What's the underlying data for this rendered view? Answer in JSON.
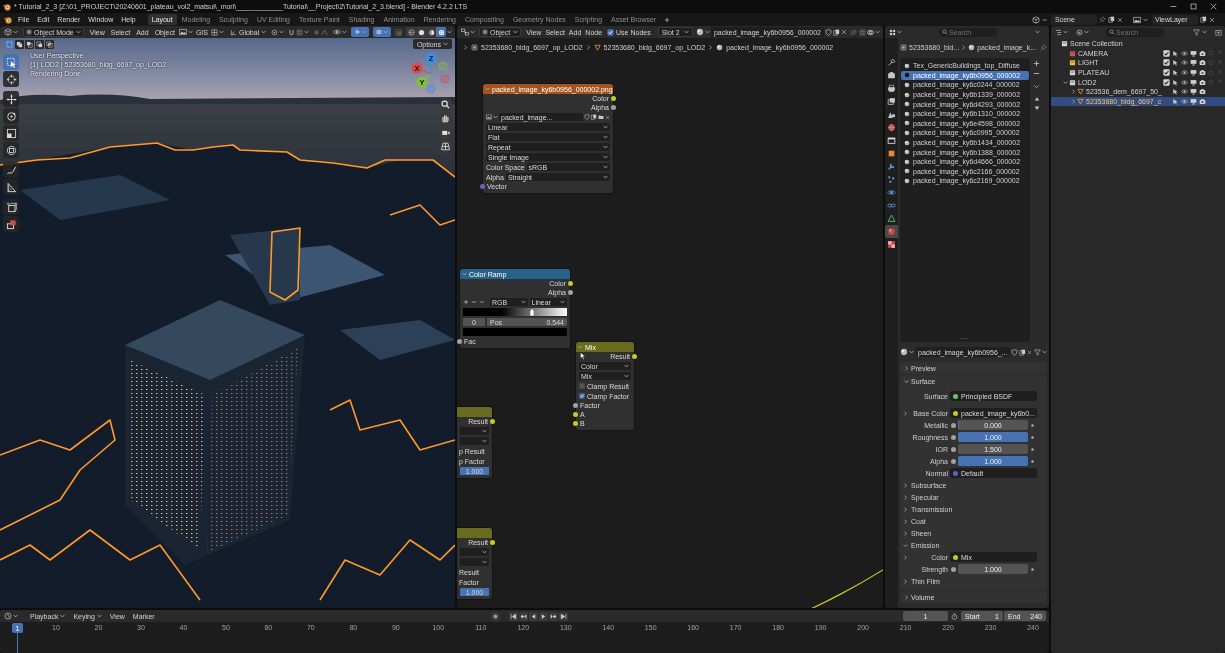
{
  "window": {
    "title": "* Tutorial_2_3 [Z:\\01_PROJECT\\20240601_plateau_vol2_matsui\\_mori\\____________Tutorial\\__Project\\2\\Tutorial_2_3.blend] - Blender 4.2.2 LTS"
  },
  "menu": [
    "File",
    "Edit",
    "Render",
    "Window",
    "Help"
  ],
  "workspaces": [
    {
      "label": "Layout",
      "selected": true
    },
    {
      "label": "Modeling",
      "selected": false
    },
    {
      "label": "Sculpting",
      "selected": false
    },
    {
      "label": "UV Editing",
      "selected": false
    },
    {
      "label": "Texture Paint",
      "selected": false
    },
    {
      "label": "Shading",
      "selected": false
    },
    {
      "label": "Animation",
      "selected": false
    },
    {
      "label": "Rendering",
      "selected": false
    },
    {
      "label": "Compositing",
      "selected": false
    },
    {
      "label": "Geometry Nodes",
      "selected": false
    },
    {
      "label": "Scripting",
      "selected": false
    },
    {
      "label": "Asset Browser",
      "selected": false
    }
  ],
  "scene": {
    "scene": "Scene",
    "view_layer": "ViewLayer"
  },
  "viewport": {
    "header": {
      "mode": "Object Mode",
      "menus": [
        "View",
        "Select",
        "Add",
        "Object"
      ],
      "addon": "GIS",
      "orientation": "Global",
      "toggles": [
        {
          "kind": "gizmo",
          "on": true
        },
        {
          "kind": "overlay",
          "on": true
        }
      ],
      "shading": [
        {
          "kind": "wireframe",
          "selected": false
        },
        {
          "kind": "solid",
          "selected": false
        },
        {
          "kind": "material",
          "selected": false
        },
        {
          "kind": "rendered",
          "selected": true
        }
      ]
    },
    "select_modes": [
      {
        "kind": "new",
        "selected": true
      },
      {
        "kind": "extend",
        "selected": false
      },
      {
        "kind": "subtract",
        "selected": false
      },
      {
        "kind": "invert",
        "selected": false
      },
      {
        "kind": "intersect",
        "selected": false
      }
    ],
    "options": "Options",
    "overlay_text": [
      "User Perspective",
      "(1) LOD2 | 52353680_bldg_6697_op_LOD2",
      "Rendering Done"
    ],
    "tools": [
      {
        "kind": "select_box",
        "selected": true
      },
      {
        "kind": "cursor",
        "selected": false
      },
      {
        "kind": "move",
        "selected": false
      },
      {
        "kind": "rotate",
        "selected": false
      },
      {
        "kind": "scale",
        "selected": false
      },
      {
        "kind": "transform",
        "selected": false
      },
      {
        "kind": "annotate",
        "selected": false
      },
      {
        "kind": "measure",
        "selected": false
      },
      {
        "kind": "add_cube",
        "selected": false
      },
      {
        "kind": "extrude",
        "selected": false
      }
    ],
    "gizmo": [
      {
        "label": "X",
        "color": "#d94a4f"
      },
      {
        "label": "Y",
        "color": "#82c03c"
      },
      {
        "label": "Z",
        "color": "#3b8ee6"
      }
    ]
  },
  "node_editor": {
    "header": {
      "type": "Object",
      "menus": [
        "View",
        "Select",
        "Add",
        "Node"
      ],
      "use_nodes": {
        "label": "Use Nodes",
        "checked": true
      },
      "slot": "Slot 2",
      "material": "packed_image_ky6b0956_000002"
    },
    "breadcrumbs": [
      {
        "kind": "object",
        "label": "52353680_bldg_6697_op_LOD2"
      },
      {
        "kind": "mesh",
        "label": "52353680_bldg_6697_op_LOD2"
      },
      {
        "kind": "material",
        "label": "packed_image_ky6b0956_000002"
      }
    ],
    "nodes": [
      {
        "kind": "texture",
        "title": "packed_image_ky6b0956_000002.png",
        "outputs": [
          {
            "label": "Color",
            "color": "#c7c729"
          },
          {
            "label": "Alpha",
            "color": "#a1a1a1"
          }
        ],
        "fields": [
          {
            "kind": "image",
            "value": "packed_image..."
          },
          {
            "kind": "dropdown",
            "value": "Linear"
          },
          {
            "kind": "dropdown",
            "value": "Flat"
          },
          {
            "kind": "dropdown",
            "value": "Repeat"
          },
          {
            "kind": "dropdown",
            "value": "Single Image"
          },
          {
            "kind": "dropdown",
            "label": "Color Space",
            "value": "sRGB"
          },
          {
            "kind": "dropdown",
            "label": "Alpha",
            "value": "Straight"
          }
        ],
        "inputs": [
          {
            "label": "Vector",
            "color": "#6363c7"
          }
        ]
      },
      {
        "kind": "converter",
        "title": "Color Ramp",
        "outputs": [
          {
            "label": "Color",
            "color": "#c7c729"
          },
          {
            "label": "Alpha",
            "color": "#a1a1a1"
          }
        ],
        "fields": [
          {
            "kind": "ramp_modes",
            "mode": "RGB",
            "interpolation": "Linear"
          },
          {
            "kind": "ramp"
          },
          {
            "kind": "stop",
            "index": "0",
            "label": "Pos",
            "value": "0.544"
          },
          {
            "kind": "swatch"
          }
        ],
        "inputs": [
          {
            "label": "Fac",
            "color": "#a1a1a1"
          }
        ]
      },
      {
        "kind": "color",
        "title": "Mix",
        "outputs": [
          {
            "label": "Result",
            "color": "#c7c729"
          }
        ],
        "fields": [
          {
            "kind": "dropdown",
            "value": "Color"
          },
          {
            "kind": "dropdown",
            "value": "Mix"
          },
          {
            "kind": "checkbox",
            "label": "Clamp Result",
            "checked": false
          },
          {
            "kind": "checkbox",
            "label": "Clamp Factor",
            "checked": true
          }
        ],
        "inputs": [
          {
            "label": "Factor",
            "color": "#a1a1a1"
          },
          {
            "label": "A",
            "color": "#c7c729"
          },
          {
            "label": "B",
            "color": "#c7c729"
          }
        ]
      },
      {
        "kind": "color",
        "outputs": [
          {
            "label": "Result",
            "color": "#c7c729"
          }
        ],
        "fields": [
          {
            "kind": "dropdown"
          },
          {
            "kind": "dropdown"
          },
          {
            "kind": "text",
            "label": "p Result"
          },
          {
            "kind": "text",
            "label": "p Factor"
          },
          {
            "kind": "slider",
            "value": "1.000",
            "level": 1
          }
        ]
      },
      {
        "kind": "color",
        "outputs": [
          {
            "label": "Result",
            "color": "#c7c729"
          }
        ],
        "fields": [
          {
            "kind": "dropdown"
          },
          {
            "kind": "dropdown"
          },
          {
            "kind": "text",
            "label": "Result"
          },
          {
            "kind": "text",
            "label": "Factor"
          },
          {
            "kind": "slider",
            "value": "1.000",
            "level": 1
          }
        ]
      }
    ]
  },
  "properties": {
    "search": {
      "placeholder": "Search"
    },
    "tabs": [
      {
        "kind": "tool",
        "selected": false
      },
      {
        "kind": "render",
        "selected": false
      },
      {
        "kind": "output",
        "selected": false
      },
      {
        "kind": "view_layer",
        "selected": false
      },
      {
        "kind": "scene",
        "selected": false
      },
      {
        "kind": "world",
        "selected": false
      },
      {
        "kind": "collection",
        "selected": false
      },
      {
        "kind": "object",
        "selected": false
      },
      {
        "kind": "modifiers",
        "selected": false
      },
      {
        "kind": "particles",
        "selected": false
      },
      {
        "kind": "physics",
        "selected": false
      },
      {
        "kind": "constraints",
        "selected": false
      },
      {
        "kind": "data",
        "selected": false
      },
      {
        "kind": "material",
        "selected": true
      },
      {
        "kind": "texture",
        "selected": false
      }
    ],
    "breadcrumbs": [
      {
        "kind": "object",
        "label": "52353680_bld..."
      },
      {
        "kind": "material",
        "label": "packed_image_k..."
      }
    ],
    "slots": [
      {
        "name": "Tex_GenericBuildings_top_Diffuse",
        "selected": false
      },
      {
        "name": "packed_image_ky6b0956_000002",
        "selected": true
      },
      {
        "name": "packed_image_ky6c0244_000002",
        "selected": false
      },
      {
        "name": "packed_image_ky6b1339_000002",
        "selected": false
      },
      {
        "name": "packed_image_ky6d4293_000002",
        "selected": false
      },
      {
        "name": "packed_image_ky6b1310_000002",
        "selected": false
      },
      {
        "name": "packed_image_ky6e4598_000002",
        "selected": false
      },
      {
        "name": "packed_image_ky6c0995_000002",
        "selected": false
      },
      {
        "name": "packed_image_ky6b1434_000002",
        "selected": false
      },
      {
        "name": "packed_image_ky6b1388_000002",
        "selected": false
      },
      {
        "name": "packed_image_ky6d4666_000002",
        "selected": false
      },
      {
        "name": "packed_image_ky6c2166_000002",
        "selected": false
      },
      {
        "name": "packed_image_ky6c2169_000002",
        "selected": false
      }
    ],
    "material": "packed_image_ky6b0956_...",
    "panels": [
      {
        "label": "Preview",
        "expanded": false
      },
      {
        "label": "Surface",
        "expanded": true,
        "rows": [
          {
            "kind": "socket",
            "label": "Surface",
            "value": "Principled BSDF",
            "color": "#63c763"
          },
          {
            "kind": "socket",
            "label": "Base Color",
            "value": "packed_image_ky6b0...",
            "color": "#c7c729",
            "expanded": false
          },
          {
            "kind": "slider",
            "label": "Metallic",
            "value": "0.000",
            "level": 0,
            "color": "#a1a1a1"
          },
          {
            "kind": "slider",
            "label": "Roughness",
            "value": "1.000",
            "level": 1,
            "color": "#a1a1a1"
          },
          {
            "kind": "number",
            "label": "IOR",
            "value": "1.500",
            "color": "#a1a1a1"
          },
          {
            "kind": "slider",
            "label": "Alpha",
            "value": "1.000",
            "level": 1,
            "color": "#a1a1a1"
          },
          {
            "kind": "socket",
            "label": "Normal",
            "value": "Default",
            "color": "#6363c7"
          },
          {
            "kind": "subpanel",
            "label": "Subsurface",
            "expanded": false
          },
          {
            "kind": "subpanel",
            "label": "Specular",
            "expanded": false
          },
          {
            "kind": "subpanel",
            "label": "Transmission",
            "expanded": false
          },
          {
            "kind": "subpanel",
            "label": "Coat",
            "expanded": false
          },
          {
            "kind": "subpanel",
            "label": "Sheen",
            "expanded": false
          },
          {
            "kind": "subpanel",
            "label": "Emission",
            "expanded": true,
            "children": [
              {
                "kind": "socket",
                "label": "Color",
                "value": "Mix",
                "color": "#c7c729",
                "expanded": false
              },
              {
                "kind": "number",
                "label": "Strength",
                "value": "1.000",
                "color": "#a1a1a1"
              }
            ]
          },
          {
            "kind": "subpanel",
            "label": "Thin Film",
            "expanded": false
          }
        ]
      },
      {
        "label": "Volume",
        "expanded": false
      }
    ]
  },
  "outliner": {
    "search": {
      "placeholder": "Search"
    },
    "tree": [
      {
        "kind": "scene",
        "label": "Scene Collection",
        "selected": false,
        "children": [
          {
            "kind": "collection",
            "label": "CAMERA",
            "color": "#e05252",
            "checked": true,
            "selected": false
          },
          {
            "kind": "collection",
            "label": "LIGHT",
            "color": "#e6c437",
            "checked": true,
            "selected": false
          },
          {
            "kind": "collection",
            "label": "PLATEAU",
            "color": "#d6d6d6",
            "checked": true,
            "selected": false
          },
          {
            "kind": "collection",
            "label": "LOD2",
            "color": "#d6d6d6",
            "checked": true,
            "expanded": true,
            "selected": false,
            "children": [
              {
                "kind": "object",
                "label": "523536_dem_6697_50_",
                "expanded": false,
                "selected": false
              },
              {
                "kind": "object",
                "label": "52353680_bldg_6697_c",
                "expanded": false,
                "selected": true
              }
            ]
          }
        ]
      }
    ]
  },
  "timeline": {
    "menus": [
      {
        "label": "Playback",
        "dropdown": true
      },
      {
        "label": "Keying",
        "dropdown": true
      },
      {
        "label": "View",
        "dropdown": false
      },
      {
        "label": "Marker",
        "dropdown": false
      }
    ],
    "current_frame": "1",
    "range": [
      {
        "label": "Start",
        "value": "1"
      },
      {
        "label": "End",
        "value": "240"
      }
    ],
    "playhead": "1",
    "ruler": [
      "10",
      "20",
      "30",
      "40",
      "50",
      "60",
      "70",
      "80",
      "90",
      "100",
      "110",
      "120",
      "130",
      "140",
      "150",
      "160",
      "170",
      "180",
      "190",
      "200",
      "210",
      "220",
      "230",
      "240"
    ]
  }
}
